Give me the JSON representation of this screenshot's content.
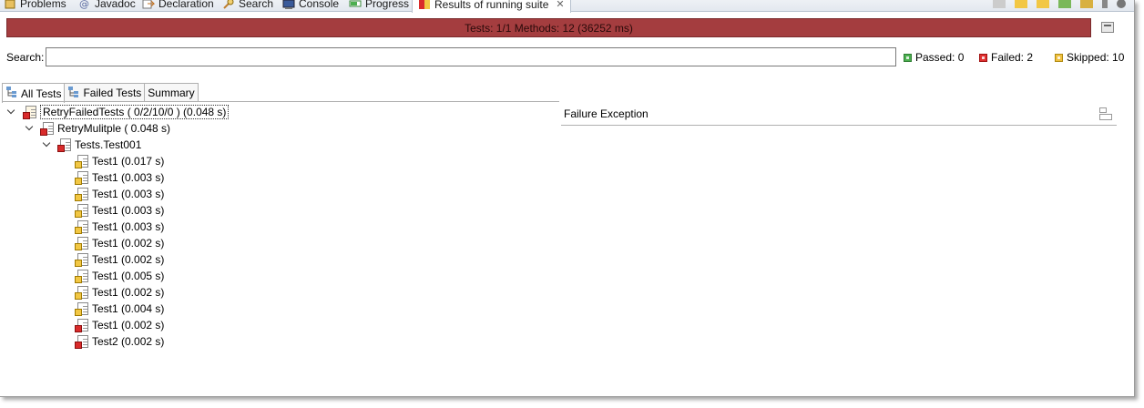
{
  "view_tabs": [
    {
      "label": "Problems",
      "icon": "problems-icon"
    },
    {
      "label": "Javadoc",
      "icon": "at-sign-icon"
    },
    {
      "label": "Declaration",
      "icon": "declaration-icon"
    },
    {
      "label": "Search",
      "icon": "search-icon"
    },
    {
      "label": "Console",
      "icon": "console-icon"
    },
    {
      "label": "Progress",
      "icon": "progress-icon"
    },
    {
      "label": "Results of running suite",
      "icon": "testng-icon",
      "active": true
    }
  ],
  "progress_bar": {
    "text": "Tests: 1/1  Methods: 12 (36252 ms)",
    "color": "#a43d3f"
  },
  "search": {
    "label": "Search:",
    "value": "",
    "placeholder": ""
  },
  "counters": {
    "passed": "Passed: 0",
    "failed": "Failed: 2",
    "skipped": "Skipped: 10"
  },
  "result_tabs": [
    {
      "label": "All Tests",
      "active": true
    },
    {
      "label": "Failed Tests",
      "active": false
    },
    {
      "label": "Summary",
      "active": false
    }
  ],
  "tree": {
    "suite": {
      "label": "RetryFailedTests ( 0/2/10/0 ) (0.048 s)"
    },
    "test": {
      "label": "RetryMulitple ( 0.048 s)"
    },
    "class": {
      "label": "Tests.Test001"
    },
    "methods": [
      {
        "label": "Test1  (0.017 s)",
        "status": "skipped"
      },
      {
        "label": "Test1  (0.003 s)",
        "status": "skipped"
      },
      {
        "label": "Test1  (0.003 s)",
        "status": "skipped"
      },
      {
        "label": "Test1  (0.003 s)",
        "status": "skipped"
      },
      {
        "label": "Test1  (0.003 s)",
        "status": "skipped"
      },
      {
        "label": "Test1  (0.002 s)",
        "status": "skipped"
      },
      {
        "label": "Test1  (0.002 s)",
        "status": "skipped"
      },
      {
        "label": "Test1  (0.005 s)",
        "status": "skipped"
      },
      {
        "label": "Test1  (0.002 s)",
        "status": "skipped"
      },
      {
        "label": "Test1  (0.004 s)",
        "status": "skipped"
      },
      {
        "label": "Test1  (0.002 s)",
        "status": "failed"
      },
      {
        "label": "Test2  (0.002 s)",
        "status": "failed"
      }
    ]
  },
  "failure_exception": {
    "title": "Failure Exception"
  }
}
